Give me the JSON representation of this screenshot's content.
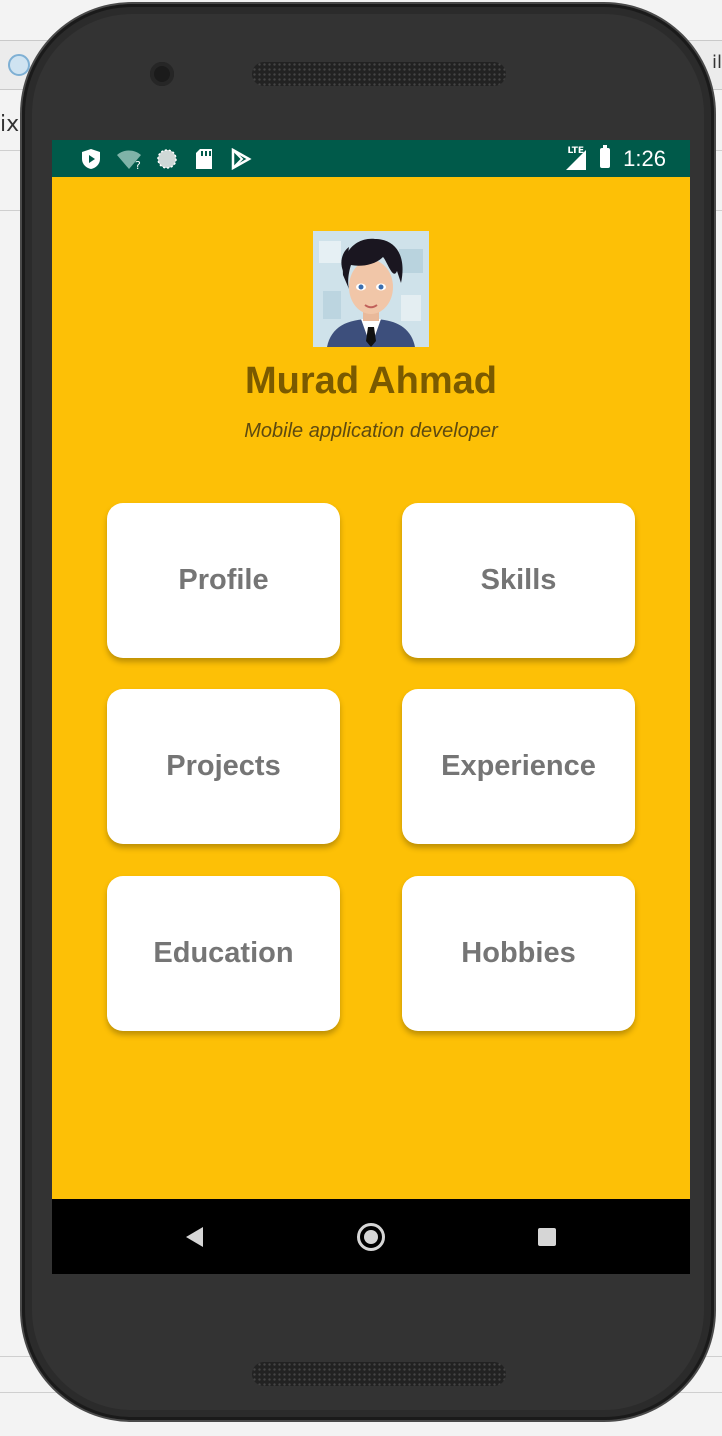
{
  "background": {
    "left_text": "ix",
    "right_text": "il"
  },
  "status_bar": {
    "time": "1:26",
    "network": "LTE",
    "icons": [
      "shield-play-icon",
      "wifi-unknown-icon",
      "sync-icon",
      "sd-card-icon",
      "play-store-icon"
    ]
  },
  "profile": {
    "name": "Murad Ahmad",
    "title": "Mobile application developer"
  },
  "menu": {
    "items": [
      "Profile",
      "Skills",
      "Projects",
      "Experience",
      "Education",
      "Hobbies"
    ]
  },
  "nav_bar": {
    "buttons": [
      "back",
      "home",
      "recents"
    ]
  },
  "colors": {
    "screen_background": "#FDC006",
    "status_bar": "#005A4A",
    "name_text": "#7A5A00",
    "card_text": "#757575"
  }
}
